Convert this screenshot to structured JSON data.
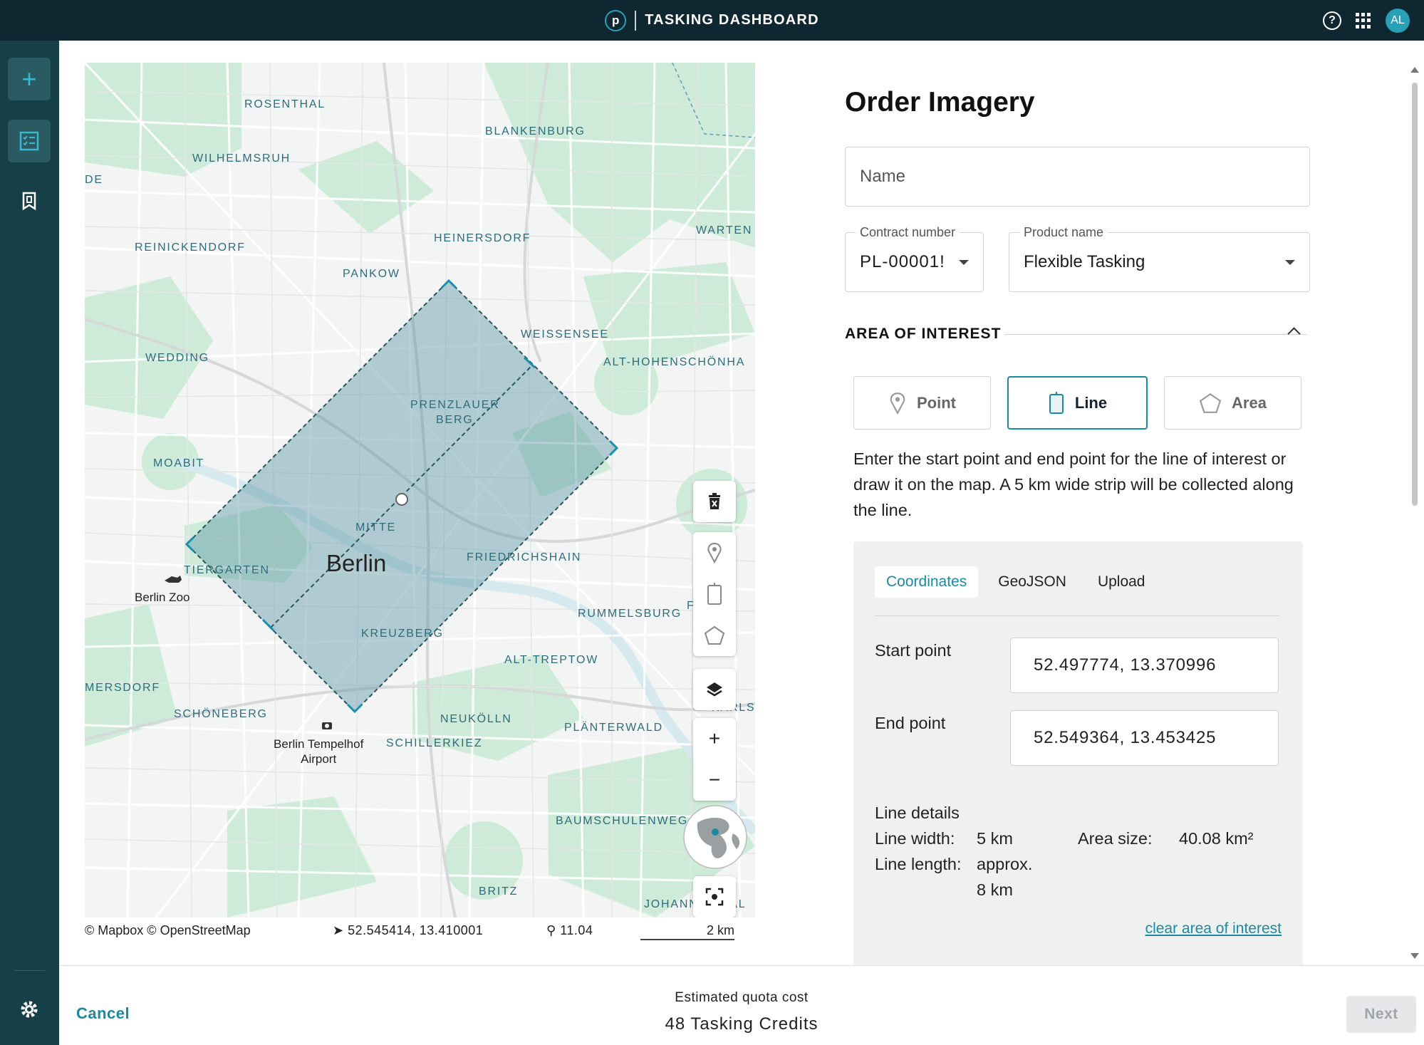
{
  "topbar": {
    "logo_letter": "p",
    "title": "TASKING DASHBOARD",
    "help": "?",
    "avatar_initials": "AL"
  },
  "rail": {
    "items": [
      {
        "icon": "plus-icon",
        "label": "+"
      },
      {
        "icon": "checklist-icon"
      },
      {
        "icon": "bookmark-building-icon"
      },
      {
        "icon": "gear-icon"
      }
    ]
  },
  "map": {
    "labels": {
      "rosenthal": "ROSENTHAL",
      "blankenburg": "BLANKENBURG",
      "wilhelmsruh": "WILHELMSRUH",
      "de": "DE",
      "reinickendorf": "REINICKENDORF",
      "heinersdorf": "HEINERSDORF",
      "warten": "WARTEN",
      "pankow": "PANKOW",
      "weissensee": "WEISSENSEE",
      "alt_hohenschonha": "ALT-HOHENSCHÖNHA",
      "wedding": "WEDDING",
      "prenzlauer_1": "PRENZLAUER",
      "prenzlauer_2": "BERG",
      "moabit": "MOABIT",
      "mitte": "MITTE",
      "friedrichshain": "FRIEDRICHSHAIN",
      "tiergarten": "TIERGARTEN",
      "rummelsburg": "RUMMELSBURG",
      "f_ich": "F         ICH",
      "kreuzberg": "KREUZBERG",
      "alt_treptow": "ALT-TREPTOW",
      "mersdorf": "MERSDORF",
      "schoneberg": "SCHÖNEBERG",
      "karls": "KARLS",
      "neukolln": "NEUKÖLLN",
      "planterwald": "PLÄNTERWALD",
      "schillerkiez": "SCHILLERKIEZ",
      "baumschulenweg": "BAUMSCHULENWEG",
      "britz": "BRITZ",
      "johannisthal": "JOHANNISTHAL"
    },
    "city": "Berlin",
    "poi_zoo": "Berlin Zoo",
    "poi_tempelhof_1": "Berlin Tempelhof",
    "poi_tempelhof_2": "Airport",
    "attribution": "© Mapbox © OpenStreetMap",
    "cursor_coords": "52.545414, 13.410001",
    "zoom": "11.04",
    "scale": "2 km",
    "tools": [
      "trash-icon",
      "point-tool-icon",
      "line-tool-icon",
      "polygon-tool-icon",
      "layers-icon",
      "zoom-in-icon",
      "zoom-out-icon",
      "globe-icon",
      "recenter-icon"
    ],
    "zoom_in": "+",
    "zoom_out": "−"
  },
  "form": {
    "title": "Order Imagery",
    "name_placeholder": "Name",
    "contract_label": "Contract number",
    "contract_value": "PL-00001!",
    "product_label": "Product name",
    "product_value": "Flexible Tasking",
    "aoi_heading": "AREA OF INTEREST",
    "geometry": {
      "point": "Point",
      "line": "Line",
      "area": "Area",
      "selected": "line"
    },
    "description": "Enter the start point and end point for the line of interest or draw it on the map. A 5 km wide strip will be collected along the line.",
    "tabs": [
      "Coordinates",
      "GeoJSON",
      "Upload"
    ],
    "active_tab": "Coordinates",
    "start_label": "Start point",
    "start_value": "52.497774, 13.370996",
    "end_label": "End point",
    "end_value": "52.549364, 13.453425",
    "details_title": "Line details",
    "width_label": "Line width:",
    "width_value": "5 km",
    "area_label": "Area size:",
    "area_value": "40.08 km²",
    "length_label": "Line length:",
    "length_value_1": "approx.",
    "length_value_2": "8 km",
    "clear_link": "clear area of interest"
  },
  "footer": {
    "cancel": "Cancel",
    "quota_label": "Estimated quota cost",
    "quota_value": "48 Tasking Credits",
    "next": "Next"
  },
  "colors": {
    "topbar": "#0f2730",
    "rail": "#163f47",
    "accent": "#1a8aa4",
    "aoi_fill": "#5e96a3"
  }
}
